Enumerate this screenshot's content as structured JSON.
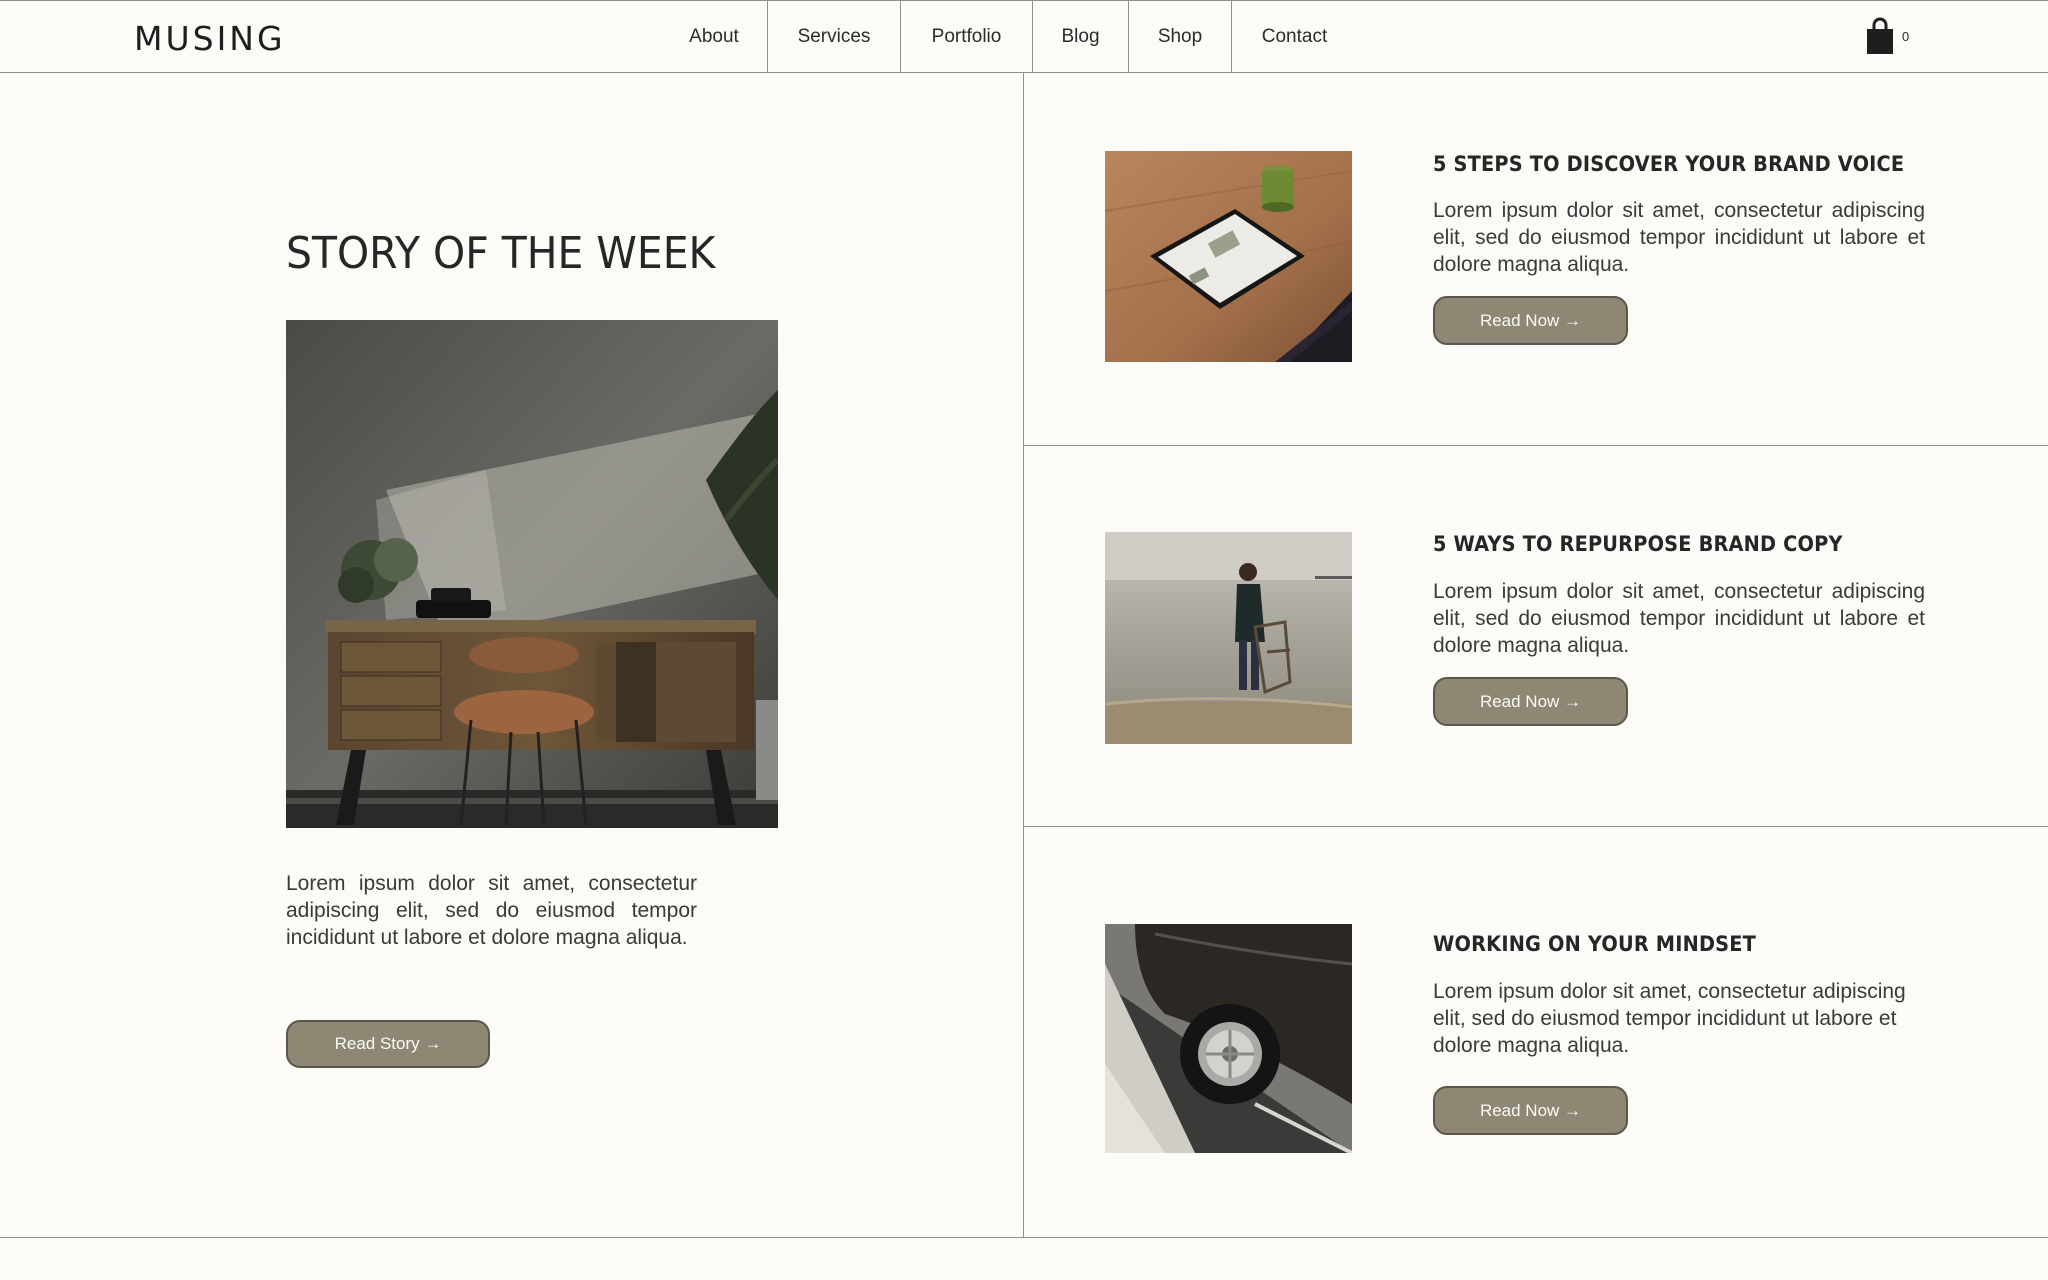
{
  "header": {
    "logo": "MUSING",
    "nav": [
      {
        "label": "About"
      },
      {
        "label": "Services"
      },
      {
        "label": "Portfolio"
      },
      {
        "label": "Blog"
      },
      {
        "label": "Shop"
      },
      {
        "label": "Contact"
      }
    ],
    "cart_count": "0",
    "cart_icon": "shopping-bag-icon"
  },
  "featured": {
    "heading": "STORY OF THE WEEK",
    "image": "desk-with-chair-and-plants-photo",
    "text": "Lorem ipsum dolor sit amet, consectetur adipiscing elit, sed do eiusmod tempor incididunt ut labore et dolore magna aliqua.",
    "button_label": "Read Story →"
  },
  "articles": [
    {
      "title": "5 STEPS TO DISCOVER YOUR BRAND VOICE",
      "image": "tablet-on-wooden-table-photo",
      "text": "Lorem ipsum dolor sit amet, consectetur adipiscing elit, sed do eiusmod tempor incididunt ut labore et dolore magna aliqua.",
      "button_label": "Read Now →"
    },
    {
      "title": "5 WAYS TO REPURPOSE BRAND COPY",
      "image": "woman-with-chair-on-beach-photo",
      "text": "Lorem ipsum dolor sit amet, consectetur adipiscing elit, sed do eiusmod tempor incididunt ut labore et dolore magna aliqua.",
      "button_label": "Read Now →"
    },
    {
      "title": "WORKING ON YOUR MINDSET",
      "image": "vintage-car-wheel-photo",
      "text": "Lorem ipsum dolor sit amet, consectetur adipiscing elit, sed do eiusmod tempor incididunt ut labore et dolore magna aliqua.",
      "button_label": "Read Now →"
    }
  ],
  "colors": {
    "background": "#fdfbf7",
    "button": "#8d8774",
    "button_border": "#5a5648",
    "divider": "#8f8f8f"
  }
}
